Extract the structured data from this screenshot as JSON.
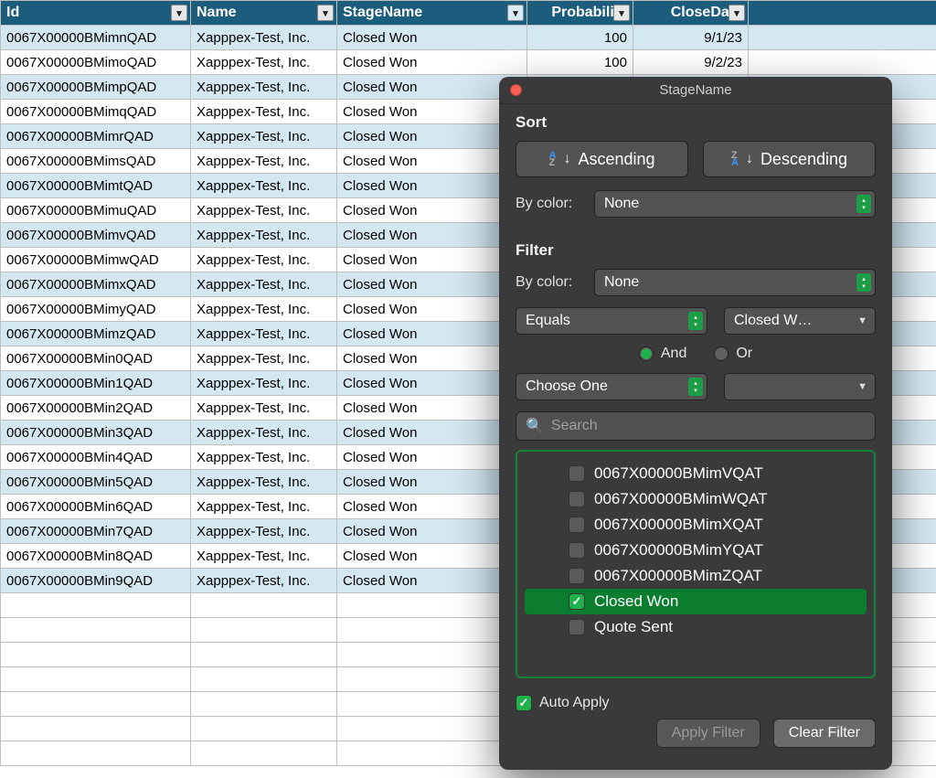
{
  "columns": {
    "id": "Id",
    "name": "Name",
    "stage": "StageName",
    "prob": "Probability",
    "close": "CloseDate"
  },
  "rows": [
    {
      "id": "0067X00000BMimnQAD",
      "name": "Xapppex-Test, Inc.",
      "stage": "Closed Won",
      "prob": "100",
      "close": "9/1/23"
    },
    {
      "id": "0067X00000BMimoQAD",
      "name": "Xapppex-Test, Inc.",
      "stage": "Closed Won",
      "prob": "100",
      "close": "9/2/23"
    },
    {
      "id": "0067X00000BMimpQAD",
      "name": "Xapppex-Test, Inc.",
      "stage": "Closed Won",
      "prob": "",
      "close": ""
    },
    {
      "id": "0067X00000BMimqQAD",
      "name": "Xapppex-Test, Inc.",
      "stage": "Closed Won",
      "prob": "",
      "close": ""
    },
    {
      "id": "0067X00000BMimrQAD",
      "name": "Xapppex-Test, Inc.",
      "stage": "Closed Won",
      "prob": "",
      "close": ""
    },
    {
      "id": "0067X00000BMimsQAD",
      "name": "Xapppex-Test, Inc.",
      "stage": "Closed Won",
      "prob": "",
      "close": ""
    },
    {
      "id": "0067X00000BMimtQAD",
      "name": "Xapppex-Test, Inc.",
      "stage": "Closed Won",
      "prob": "",
      "close": ""
    },
    {
      "id": "0067X00000BMimuQAD",
      "name": "Xapppex-Test, Inc.",
      "stage": "Closed Won",
      "prob": "",
      "close": ""
    },
    {
      "id": "0067X00000BMimvQAD",
      "name": "Xapppex-Test, Inc.",
      "stage": "Closed Won",
      "prob": "",
      "close": ""
    },
    {
      "id": "0067X00000BMimwQAD",
      "name": "Xapppex-Test, Inc.",
      "stage": "Closed Won",
      "prob": "",
      "close": ""
    },
    {
      "id": "0067X00000BMimxQAD",
      "name": "Xapppex-Test, Inc.",
      "stage": "Closed Won",
      "prob": "",
      "close": ""
    },
    {
      "id": "0067X00000BMimyQAD",
      "name": "Xapppex-Test, Inc.",
      "stage": "Closed Won",
      "prob": "",
      "close": ""
    },
    {
      "id": "0067X00000BMimzQAD",
      "name": "Xapppex-Test, Inc.",
      "stage": "Closed Won",
      "prob": "",
      "close": ""
    },
    {
      "id": "0067X00000BMin0QAD",
      "name": "Xapppex-Test, Inc.",
      "stage": "Closed Won",
      "prob": "",
      "close": ""
    },
    {
      "id": "0067X00000BMin1QAD",
      "name": "Xapppex-Test, Inc.",
      "stage": "Closed Won",
      "prob": "",
      "close": ""
    },
    {
      "id": "0067X00000BMin2QAD",
      "name": "Xapppex-Test, Inc.",
      "stage": "Closed Won",
      "prob": "",
      "close": ""
    },
    {
      "id": "0067X00000BMin3QAD",
      "name": "Xapppex-Test, Inc.",
      "stage": "Closed Won",
      "prob": "",
      "close": ""
    },
    {
      "id": "0067X00000BMin4QAD",
      "name": "Xapppex-Test, Inc.",
      "stage": "Closed Won",
      "prob": "",
      "close": ""
    },
    {
      "id": "0067X00000BMin5QAD",
      "name": "Xapppex-Test, Inc.",
      "stage": "Closed Won",
      "prob": "",
      "close": ""
    },
    {
      "id": "0067X00000BMin6QAD",
      "name": "Xapppex-Test, Inc.",
      "stage": "Closed Won",
      "prob": "",
      "close": ""
    },
    {
      "id": "0067X00000BMin7QAD",
      "name": "Xapppex-Test, Inc.",
      "stage": "Closed Won",
      "prob": "",
      "close": ""
    },
    {
      "id": "0067X00000BMin8QAD",
      "name": "Xapppex-Test, Inc.",
      "stage": "Closed Won",
      "prob": "",
      "close": ""
    },
    {
      "id": "0067X00000BMin9QAD",
      "name": "Xapppex-Test, Inc.",
      "stage": "Closed Won",
      "prob": "",
      "close": ""
    }
  ],
  "popup": {
    "title": "StageName",
    "sort_label": "Sort",
    "asc": "Ascending",
    "desc": "Descending",
    "by_color": "By color:",
    "none": "None",
    "filter_label": "Filter",
    "operator": "Equals",
    "value1": "Closed W…",
    "and": "And",
    "or": "Or",
    "choose": "Choose One",
    "search_placeholder": "Search",
    "items": [
      {
        "label": "0067X00000BMimVQAT",
        "checked": false
      },
      {
        "label": "0067X00000BMimWQAT",
        "checked": false
      },
      {
        "label": "0067X00000BMimXQAT",
        "checked": false
      },
      {
        "label": "0067X00000BMimYQAT",
        "checked": false
      },
      {
        "label": "0067X00000BMimZQAT",
        "checked": false
      },
      {
        "label": "Closed Won",
        "checked": true
      },
      {
        "label": "Quote Sent",
        "checked": false
      }
    ],
    "auto_apply": "Auto Apply",
    "apply": "Apply Filter",
    "clear": "Clear Filter"
  }
}
